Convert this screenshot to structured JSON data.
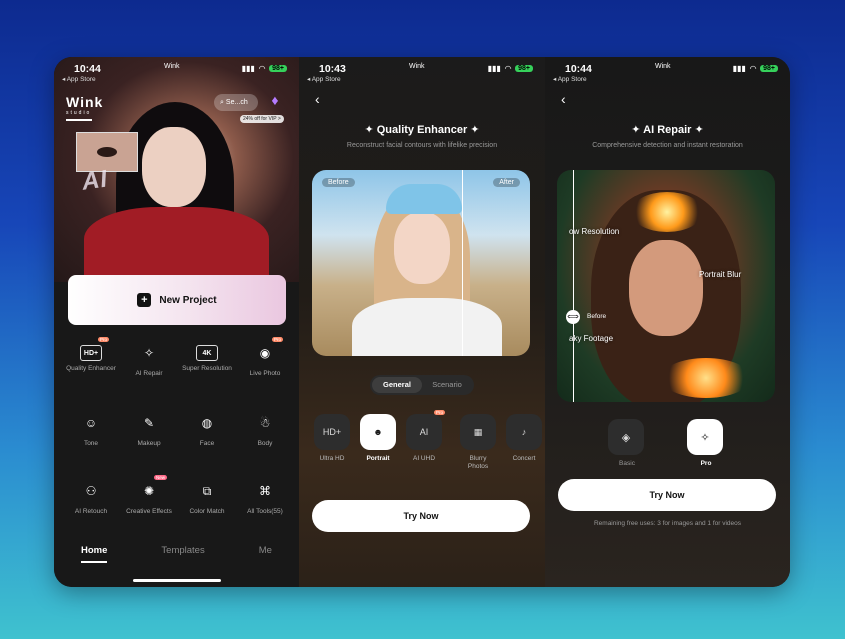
{
  "panel1": {
    "status": {
      "time": "10:44",
      "back": "◂ App Store",
      "carrier": "Wink",
      "battery": "98+"
    },
    "logo": "Wink",
    "logo_sub": "studio",
    "search_placeholder": "Se...ch",
    "promo": "24% off for VIP >",
    "new_project": "New Project",
    "tools": [
      {
        "label": "Quality Enhancer",
        "icon": "HD+",
        "tag": "Pro"
      },
      {
        "label": "AI Repair",
        "icon": "✧",
        "tag": ""
      },
      {
        "label": "Super Resolution",
        "icon": "4K",
        "tag": ""
      },
      {
        "label": "Live Photo",
        "icon": "◉",
        "tag": "Pro"
      },
      {
        "label": "Tone",
        "icon": "☺",
        "tag": ""
      },
      {
        "label": "Makeup",
        "icon": "✎",
        "tag": ""
      },
      {
        "label": "Face",
        "icon": "◍",
        "tag": ""
      },
      {
        "label": "Body",
        "icon": "☃",
        "tag": ""
      },
      {
        "label": "AI Retouch",
        "icon": "⚇",
        "tag": ""
      },
      {
        "label": "Creative Effects",
        "icon": "✺",
        "tag": "New"
      },
      {
        "label": "Color Match",
        "icon": "⧉",
        "tag": ""
      },
      {
        "label": "All Tools(55)",
        "icon": "⌘",
        "tag": ""
      }
    ],
    "nav": {
      "home": "Home",
      "templates": "Templates",
      "me": "Me"
    }
  },
  "panel2": {
    "status": {
      "time": "10:43",
      "back": "◂ App Store",
      "carrier": "Wink",
      "battery": "98+"
    },
    "title": "Quality Enhancer",
    "subtitle": "Reconstruct facial contours with lifelike precision",
    "before": "Before",
    "after": "After",
    "seg_general": "General",
    "seg_scenario": "Scenario",
    "modes": [
      {
        "label": "Ultra HD",
        "icon": "HD+",
        "tag": ""
      },
      {
        "label": "Portrait",
        "icon": "☻",
        "tag": ""
      },
      {
        "label": "AI UHD",
        "icon": "AI",
        "tag": "Pro"
      },
      {
        "label": "Blurry Photos",
        "icon": "▦",
        "tag": ""
      },
      {
        "label": "Concert",
        "icon": "♪",
        "tag": ""
      }
    ],
    "try_now": "Try Now"
  },
  "panel3": {
    "status": {
      "time": "10:44",
      "back": "◂ App Store",
      "carrier": "Wink",
      "battery": "98+"
    },
    "title": "AI Repair",
    "subtitle": "Comprehensive detection and instant restoration",
    "ann_low_res": "ow Resolution",
    "ann_portrait_blur": "Portrait Blur",
    "ann_shaky": "aky Footage",
    "before": "Before",
    "options": [
      {
        "label": "Basic",
        "icon": "◈"
      },
      {
        "label": "Pro",
        "icon": "✧"
      }
    ],
    "try_now": "Try Now",
    "remaining": "Remaining free uses: 3 for images and 1 for videos"
  }
}
